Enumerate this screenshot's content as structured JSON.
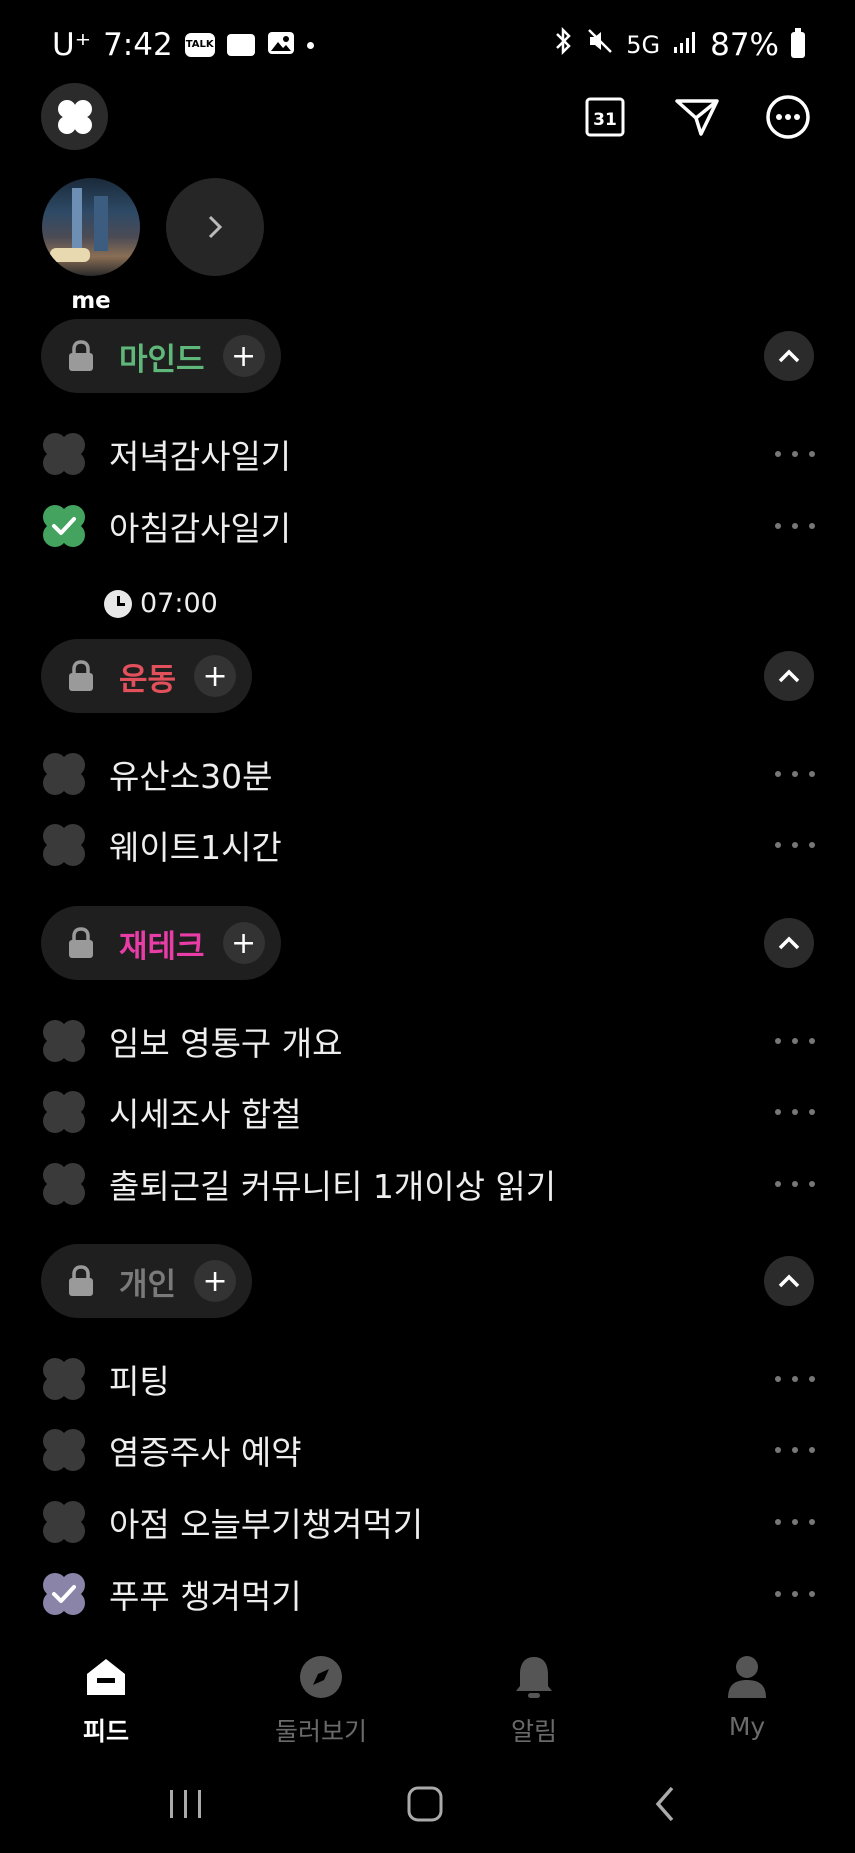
{
  "status_bar": {
    "carrier": "U⁺",
    "time": "7:42",
    "talk_icon_text": "TALK",
    "network": "5G",
    "battery": "87%"
  },
  "header": {
    "calendar_icon_text": "31"
  },
  "profile": {
    "name": "me"
  },
  "sections": [
    {
      "title": "마인드",
      "color": "#5fb87a",
      "tasks": [
        {
          "label": "저녁감사일기",
          "checked": false
        },
        {
          "label": "아침감사일기",
          "checked": true,
          "time": "07:00"
        }
      ]
    },
    {
      "title": "운동",
      "color": "#e2505c",
      "tasks": [
        {
          "label": "유산소30분",
          "checked": false
        },
        {
          "label": "웨이트1시간",
          "checked": false
        }
      ]
    },
    {
      "title": "재테크",
      "color": "#e83ca6",
      "tasks": [
        {
          "label": "임보 영통구 개요",
          "checked": false
        },
        {
          "label": "시세조사 합철",
          "checked": false
        },
        {
          "label": "출퇴근길 커뮤니티 1개이상 읽기",
          "checked": false
        }
      ]
    },
    {
      "title": "개인",
      "color": "#7a7a7a",
      "tasks": [
        {
          "label": "피팅",
          "checked": false
        },
        {
          "label": "염증주사 예약",
          "checked": false
        },
        {
          "label": "아점 오늘부기챙겨먹기",
          "checked": false
        },
        {
          "label": "푸푸 챙겨먹기",
          "checked": true
        }
      ]
    }
  ],
  "bottom_nav": [
    {
      "label": "피드",
      "icon": "home-icon",
      "active": true
    },
    {
      "label": "둘러보기",
      "icon": "compass-icon",
      "active": false
    },
    {
      "label": "알림",
      "icon": "bell-icon",
      "active": false
    },
    {
      "label": "My",
      "icon": "person-icon",
      "active": false
    }
  ]
}
